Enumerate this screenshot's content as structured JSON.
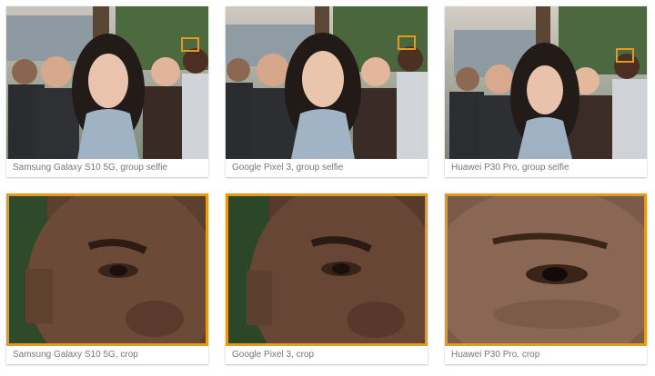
{
  "gallery": {
    "cards": [
      {
        "caption": "Samsung Galaxy S10 5G, group selfie",
        "image": "group-selfie"
      },
      {
        "caption": "Google Pixel 3, group selfie",
        "image": "group-selfie"
      },
      {
        "caption": "Huawei P30 Pro, group selfie",
        "image": "group-selfie"
      },
      {
        "caption": "Samsung Galaxy S10 5G, crop",
        "image": "face-crop"
      },
      {
        "caption": "Google Pixel 3, crop",
        "image": "face-crop"
      },
      {
        "caption": "Huawei P30 Pro, crop",
        "image": "face-crop"
      }
    ]
  },
  "colors": {
    "highlight": "#E59A1B",
    "caption_text": "#777777"
  }
}
